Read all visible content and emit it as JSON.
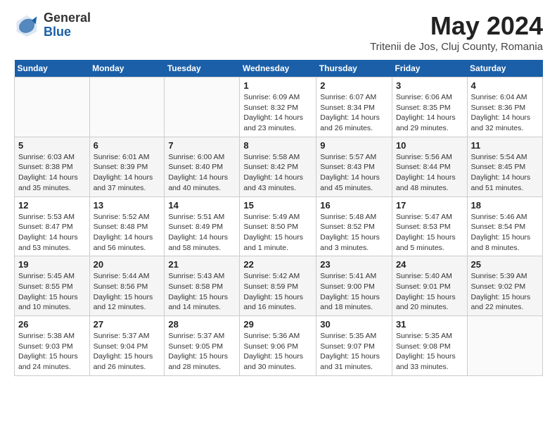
{
  "header": {
    "logo_general": "General",
    "logo_blue": "Blue",
    "title": "May 2024",
    "location": "Tritenii de Jos, Cluj County, Romania"
  },
  "weekdays": [
    "Sunday",
    "Monday",
    "Tuesday",
    "Wednesday",
    "Thursday",
    "Friday",
    "Saturday"
  ],
  "weeks": [
    [
      {
        "day": "",
        "info": ""
      },
      {
        "day": "",
        "info": ""
      },
      {
        "day": "",
        "info": ""
      },
      {
        "day": "1",
        "info": "Sunrise: 6:09 AM\nSunset: 8:32 PM\nDaylight: 14 hours\nand 23 minutes."
      },
      {
        "day": "2",
        "info": "Sunrise: 6:07 AM\nSunset: 8:34 PM\nDaylight: 14 hours\nand 26 minutes."
      },
      {
        "day": "3",
        "info": "Sunrise: 6:06 AM\nSunset: 8:35 PM\nDaylight: 14 hours\nand 29 minutes."
      },
      {
        "day": "4",
        "info": "Sunrise: 6:04 AM\nSunset: 8:36 PM\nDaylight: 14 hours\nand 32 minutes."
      }
    ],
    [
      {
        "day": "5",
        "info": "Sunrise: 6:03 AM\nSunset: 8:38 PM\nDaylight: 14 hours\nand 35 minutes."
      },
      {
        "day": "6",
        "info": "Sunrise: 6:01 AM\nSunset: 8:39 PM\nDaylight: 14 hours\nand 37 minutes."
      },
      {
        "day": "7",
        "info": "Sunrise: 6:00 AM\nSunset: 8:40 PM\nDaylight: 14 hours\nand 40 minutes."
      },
      {
        "day": "8",
        "info": "Sunrise: 5:58 AM\nSunset: 8:42 PM\nDaylight: 14 hours\nand 43 minutes."
      },
      {
        "day": "9",
        "info": "Sunrise: 5:57 AM\nSunset: 8:43 PM\nDaylight: 14 hours\nand 45 minutes."
      },
      {
        "day": "10",
        "info": "Sunrise: 5:56 AM\nSunset: 8:44 PM\nDaylight: 14 hours\nand 48 minutes."
      },
      {
        "day": "11",
        "info": "Sunrise: 5:54 AM\nSunset: 8:45 PM\nDaylight: 14 hours\nand 51 minutes."
      }
    ],
    [
      {
        "day": "12",
        "info": "Sunrise: 5:53 AM\nSunset: 8:47 PM\nDaylight: 14 hours\nand 53 minutes."
      },
      {
        "day": "13",
        "info": "Sunrise: 5:52 AM\nSunset: 8:48 PM\nDaylight: 14 hours\nand 56 minutes."
      },
      {
        "day": "14",
        "info": "Sunrise: 5:51 AM\nSunset: 8:49 PM\nDaylight: 14 hours\nand 58 minutes."
      },
      {
        "day": "15",
        "info": "Sunrise: 5:49 AM\nSunset: 8:50 PM\nDaylight: 15 hours\nand 1 minute."
      },
      {
        "day": "16",
        "info": "Sunrise: 5:48 AM\nSunset: 8:52 PM\nDaylight: 15 hours\nand 3 minutes."
      },
      {
        "day": "17",
        "info": "Sunrise: 5:47 AM\nSunset: 8:53 PM\nDaylight: 15 hours\nand 5 minutes."
      },
      {
        "day": "18",
        "info": "Sunrise: 5:46 AM\nSunset: 8:54 PM\nDaylight: 15 hours\nand 8 minutes."
      }
    ],
    [
      {
        "day": "19",
        "info": "Sunrise: 5:45 AM\nSunset: 8:55 PM\nDaylight: 15 hours\nand 10 minutes."
      },
      {
        "day": "20",
        "info": "Sunrise: 5:44 AM\nSunset: 8:56 PM\nDaylight: 15 hours\nand 12 minutes."
      },
      {
        "day": "21",
        "info": "Sunrise: 5:43 AM\nSunset: 8:58 PM\nDaylight: 15 hours\nand 14 minutes."
      },
      {
        "day": "22",
        "info": "Sunrise: 5:42 AM\nSunset: 8:59 PM\nDaylight: 15 hours\nand 16 minutes."
      },
      {
        "day": "23",
        "info": "Sunrise: 5:41 AM\nSunset: 9:00 PM\nDaylight: 15 hours\nand 18 minutes."
      },
      {
        "day": "24",
        "info": "Sunrise: 5:40 AM\nSunset: 9:01 PM\nDaylight: 15 hours\nand 20 minutes."
      },
      {
        "day": "25",
        "info": "Sunrise: 5:39 AM\nSunset: 9:02 PM\nDaylight: 15 hours\nand 22 minutes."
      }
    ],
    [
      {
        "day": "26",
        "info": "Sunrise: 5:38 AM\nSunset: 9:03 PM\nDaylight: 15 hours\nand 24 minutes."
      },
      {
        "day": "27",
        "info": "Sunrise: 5:37 AM\nSunset: 9:04 PM\nDaylight: 15 hours\nand 26 minutes."
      },
      {
        "day": "28",
        "info": "Sunrise: 5:37 AM\nSunset: 9:05 PM\nDaylight: 15 hours\nand 28 minutes."
      },
      {
        "day": "29",
        "info": "Sunrise: 5:36 AM\nSunset: 9:06 PM\nDaylight: 15 hours\nand 30 minutes."
      },
      {
        "day": "30",
        "info": "Sunrise: 5:35 AM\nSunset: 9:07 PM\nDaylight: 15 hours\nand 31 minutes."
      },
      {
        "day": "31",
        "info": "Sunrise: 5:35 AM\nSunset: 9:08 PM\nDaylight: 15 hours\nand 33 minutes."
      },
      {
        "day": "",
        "info": ""
      }
    ]
  ]
}
